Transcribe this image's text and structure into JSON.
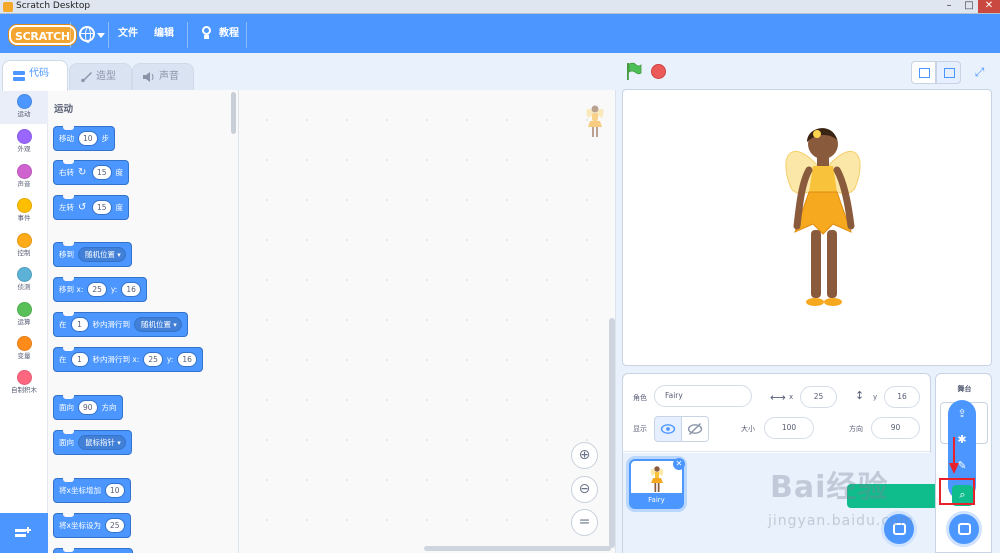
{
  "window": {
    "title": "Scratch Desktop"
  },
  "menubar": {
    "logo_text": "SCRATCH",
    "file": "文件",
    "edit": "编辑",
    "tutorials": "教程"
  },
  "tabs": [
    {
      "label": "代码"
    },
    {
      "label": "造型"
    },
    {
      "label": "声音"
    }
  ],
  "categories": [
    {
      "label": "运动",
      "color": "#4c97ff"
    },
    {
      "label": "外观",
      "color": "#9966ff"
    },
    {
      "label": "声音",
      "color": "#cf63cf"
    },
    {
      "label": "事件",
      "color": "#ffbf00"
    },
    {
      "label": "控制",
      "color": "#ffab19"
    },
    {
      "label": "侦测",
      "color": "#5cb1d6"
    },
    {
      "label": "运算",
      "color": "#59c059"
    },
    {
      "label": "变量",
      "color": "#ff8c1a"
    },
    {
      "label": "自制积木",
      "color": "#ff6680"
    }
  ],
  "palette": {
    "heading": "运动",
    "move": {
      "a": "移动",
      "v": "10",
      "b": "步"
    },
    "turn_right": {
      "a": "右转",
      "v": "15",
      "b": "度"
    },
    "turn_left": {
      "a": "左转",
      "v": "15",
      "b": "度"
    },
    "goto": {
      "a": "移到",
      "opt": "随机位置"
    },
    "goto_xy": {
      "a": "移到 x:",
      "x": "25",
      "b": "y:",
      "y": "16"
    },
    "glide": {
      "a": "在",
      "v": "1",
      "b": "秒内滑行到",
      "opt": "随机位置"
    },
    "glide_xy": {
      "a": "在",
      "v": "1",
      "b": "秒内滑行到 x:",
      "x": "25",
      "c": "y:",
      "y": "16"
    },
    "point": {
      "a": "面向",
      "v": "90",
      "b": "方向"
    },
    "point_towards": {
      "a": "面向",
      "opt": "鼠标指针"
    },
    "change_x": {
      "a": "将x坐标增加",
      "v": "10"
    },
    "set_x": {
      "a": "将x坐标设为",
      "v": "25"
    }
  },
  "sprite_info": {
    "sprite_label": "角色",
    "name": "Fairy",
    "x_label": "x",
    "x": "25",
    "y_label": "y",
    "y": "16",
    "show_label": "显示",
    "size_label": "大小",
    "size": "100",
    "direction_label": "方向",
    "direction": "90"
  },
  "sprites": [
    {
      "name": "Fairy"
    }
  ],
  "stage_panel": {
    "label": "舞台"
  },
  "watermark": {
    "main": "Bai经验",
    "sub": "jingyan.baidu.com"
  }
}
